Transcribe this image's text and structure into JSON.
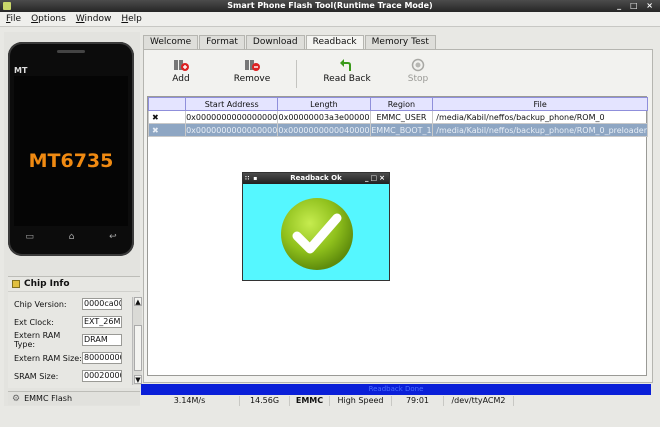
{
  "window": {
    "title": "Smart Phone Flash Tool(Runtime Trace Mode)",
    "controls": "_ □ ×"
  },
  "menu": [
    "File",
    "Options",
    "Window",
    "Help"
  ],
  "phone": {
    "brand": "MT",
    "chip": "MT6735",
    "nav": [
      "▭",
      "⌂",
      "↩"
    ]
  },
  "chip_info": {
    "title": "Chip Info",
    "fields": [
      {
        "label": "Chip Version:",
        "value": "0000ca00"
      },
      {
        "label": "Ext Clock:",
        "value": "EXT_26M"
      },
      {
        "label": "Extern RAM Type:",
        "value": "DRAM"
      },
      {
        "label": "Extern RAM Size:",
        "value": "80000000"
      },
      {
        "label": "SRAM Size:",
        "value": "00020000"
      }
    ]
  },
  "emmc_flash": "EMMC Flash",
  "tabs": [
    "Welcome",
    "Format",
    "Download",
    "Readback",
    "Memory Test"
  ],
  "active_tab": "Readback",
  "toolbar": {
    "add": "Add",
    "remove": "Remove",
    "read_back": "Read Back",
    "stop": "Stop"
  },
  "table": {
    "columns": [
      "",
      "Start Address",
      "Length",
      "Region",
      "File"
    ],
    "rows": [
      {
        "check": "✖",
        "start": "0x0000000000000000",
        "length": "0x00000003a3e00000",
        "region": "EMMC_USER",
        "file": "/media/Kabil/neffos/backup_phone/ROM_0"
      },
      {
        "check": "✖",
        "start": "0x0000000000000000",
        "length": "0x0000000000040000",
        "region": "EMMC_BOOT_1",
        "file": "/media/Kabil/neffos/backup_phone/ROM_0_preloader"
      }
    ]
  },
  "status": {
    "progress_text": "Readback Done",
    "speed": "3.14M/s",
    "size": "14.56G",
    "storage": "EMMC",
    "mode": "High Speed",
    "time": "79:01",
    "port": "/dev/ttyACM2"
  },
  "dialog": {
    "title": "Readback Ok",
    "accent": "#55f7ff",
    "icon": "checkmark-icon"
  },
  "colors": {
    "chip_text": "#f08a12",
    "progress": "#0a1fd8",
    "selected_row": "#8ea6c3"
  }
}
